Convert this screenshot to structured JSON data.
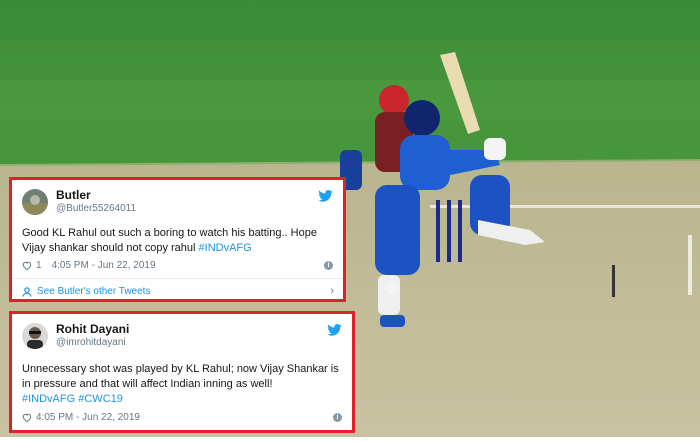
{
  "tweets": [
    {
      "name": "Butler",
      "handle": "@Butler55264011",
      "text_pre": "Good KL Rahul out such a boring to watch his batting.. Hope Vijay shankar should not copy rahul ",
      "hashtags": [
        "#INDvAFG"
      ],
      "likes": "1",
      "time": "4:05 PM - Jun 22, 2019",
      "more_label": "See Butler's other Tweets",
      "icons": [
        "twitter-bird-icon",
        "heart-icon",
        "info-icon",
        "person-icon",
        "chevron-right-icon"
      ]
    },
    {
      "name": "Rohit Dayani",
      "handle": "@imrohitdayani",
      "text_pre": "Unnecessary shot was played by KL Rahul; now Vijay Shankar is in pressure and that will affect Indian inning as well!",
      "hashtags": [
        "#INDvAFG",
        "#CWC19"
      ],
      "likes": "",
      "time": "4:05 PM - Jun 22, 2019",
      "icons": [
        "twitter-bird-icon",
        "heart-icon",
        "info-icon"
      ]
    }
  ],
  "colors": {
    "highlight_border": "#e0202a",
    "twitter_blue": "#1da1f2",
    "link": "#1b95e0"
  }
}
